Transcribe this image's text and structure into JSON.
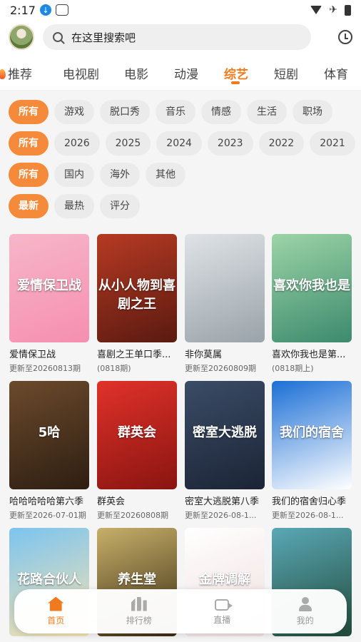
{
  "status_bar": {
    "time": "2:17"
  },
  "search": {
    "placeholder": "在这里搜索吧"
  },
  "categories": [
    "推荐",
    "电视剧",
    "电影",
    "动漫",
    "综艺",
    "短剧",
    "体育"
  ],
  "active_category": "综艺",
  "filters": {
    "genre": [
      "所有",
      "游戏",
      "脱口秀",
      "音乐",
      "情感",
      "生活",
      "职场"
    ],
    "year": [
      "所有",
      "2026",
      "2025",
      "2024",
      "2023",
      "2022",
      "2021"
    ],
    "region": [
      "所有",
      "国内",
      "海外",
      "其他"
    ],
    "sort": [
      "最新",
      "最热",
      "评分"
    ]
  },
  "shows": [
    {
      "title": "爱情保卫战",
      "sub": "更新至20260813期",
      "poster_text": "爱情保卫战",
      "colors": [
        "#f7b6c9",
        "#f58fb0"
      ]
    },
    {
      "title": "喜剧之王单口季...",
      "sub": "(0818期)",
      "poster_text": "从小人物到喜剧之王",
      "colors": [
        "#b63a23",
        "#5a1a10"
      ]
    },
    {
      "title": "非你莫属",
      "sub": "更新至20260809期",
      "poster_text": "",
      "colors": [
        "#dfe3e6",
        "#9aa3aa"
      ]
    },
    {
      "title": "喜欢你我也是第...",
      "sub": "(0818期上)",
      "poster_text": "喜欢你我也是",
      "colors": [
        "#9cd4a6",
        "#3c8a6e"
      ]
    },
    {
      "title": "哈哈哈哈哈第六季",
      "sub": "更新至2026-07-01期",
      "poster_text": "5哈",
      "colors": [
        "#6b4a2c",
        "#2e1e12"
      ]
    },
    {
      "title": "群英会",
      "sub": "更新至20260808期",
      "poster_text": "群英会",
      "colors": [
        "#e0322a",
        "#8a1410"
      ]
    },
    {
      "title": "密室大逃脱第八季",
      "sub": "更新至2026-08-1...",
      "poster_text": "密室大逃脱",
      "colors": [
        "#3b4c66",
        "#1b2436"
      ]
    },
    {
      "title": "我们的宿舍归心季",
      "sub": "更新至2026-08-1...",
      "poster_text": "我们的宿舍",
      "colors": [
        "#1b6fd6",
        "#ffffff"
      ]
    },
    {
      "title": "",
      "sub": "",
      "poster_text": "花路合伙人",
      "colors": [
        "#7cc4f0",
        "#f6e3b0"
      ]
    },
    {
      "title": "",
      "sub": "",
      "poster_text": "养生堂",
      "colors": [
        "#c7b06a",
        "#3a2a12"
      ]
    },
    {
      "title": "",
      "sub": "",
      "poster_text": "金牌调解",
      "colors": [
        "#ffffff",
        "#f0dede"
      ]
    },
    {
      "title": "",
      "sub": "",
      "poster_text": "",
      "colors": [
        "#5aa8b5",
        "#214a3a"
      ]
    }
  ],
  "bottom_nav": [
    {
      "label": "首页",
      "icon": "home-icon"
    },
    {
      "label": "排行榜",
      "icon": "rank-icon"
    },
    {
      "label": "直播",
      "icon": "live-icon"
    },
    {
      "label": "我的",
      "icon": "profile-icon"
    }
  ],
  "accent": "#f07a1e"
}
